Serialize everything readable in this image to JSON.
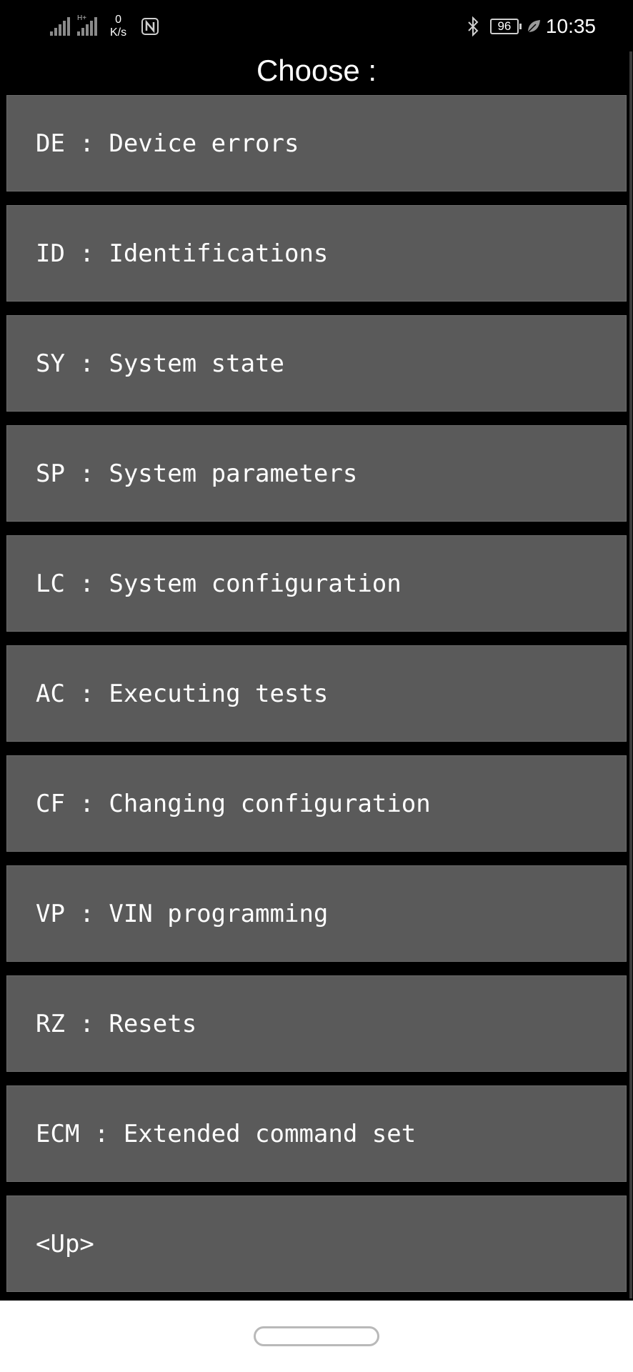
{
  "status_bar": {
    "net_speed_value": "0",
    "net_speed_unit": "K/s",
    "network_tag": "H+",
    "battery": "96",
    "time": "10:35"
  },
  "header": {
    "title": "Choose :"
  },
  "menu": {
    "items": [
      {
        "label": "DE : Device errors"
      },
      {
        "label": "ID : Identifications"
      },
      {
        "label": "SY : System state"
      },
      {
        "label": "SP : System parameters"
      },
      {
        "label": "LC : System configuration"
      },
      {
        "label": "AC : Executing tests"
      },
      {
        "label": "CF : Changing configuration"
      },
      {
        "label": "VP : VIN programming"
      },
      {
        "label": "RZ : Resets"
      },
      {
        "label": "ECM : Extended command set"
      },
      {
        "label": "<Up>"
      }
    ]
  },
  "colors": {
    "background": "#000000",
    "menu_item_bg": "#5a5a5a",
    "text": "#ffffff",
    "nav_bar_bg": "#ffffff"
  },
  "icons": {
    "signal_1": "cell-signal-icon",
    "signal_2": "cell-signal-icon",
    "nfc": "nfc-icon",
    "bluetooth": "bluetooth-icon",
    "battery": "battery-icon",
    "power_saving": "leaf-icon"
  }
}
